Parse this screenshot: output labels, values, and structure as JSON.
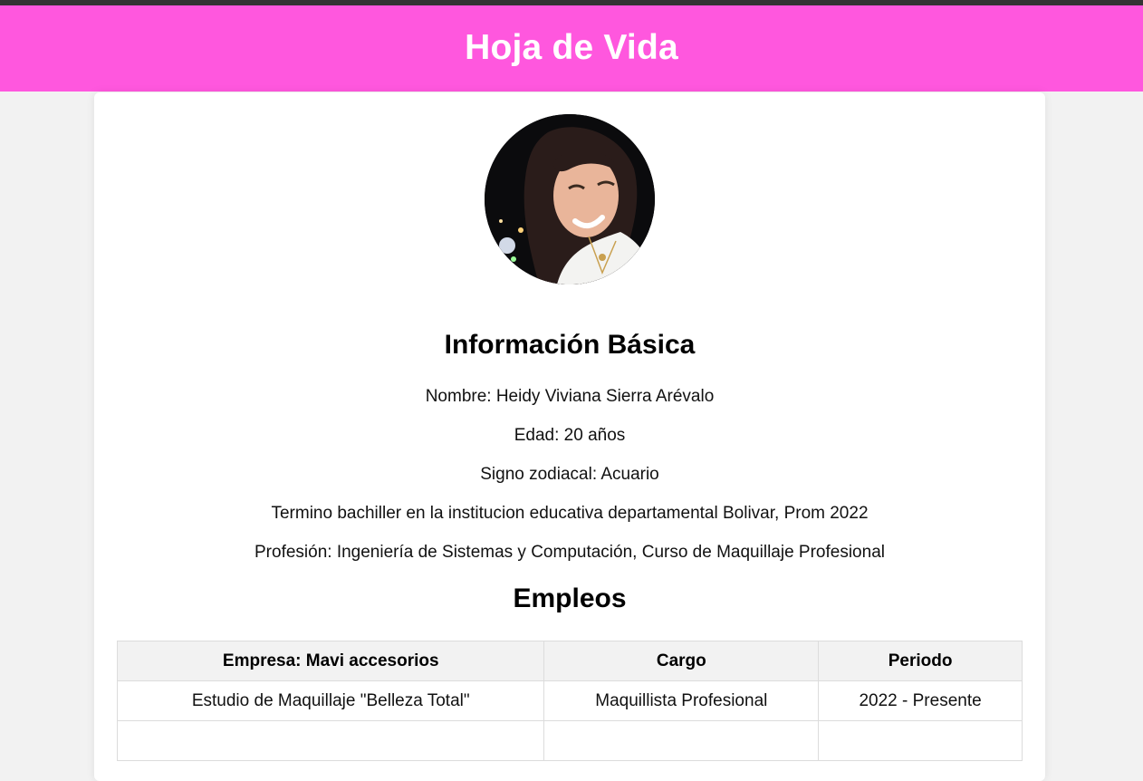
{
  "page": {
    "title": "Hoja de Vida"
  },
  "basic_info": {
    "heading": "Información Básica",
    "lines": [
      "Nombre: Heidy Viviana Sierra Arévalo",
      "Edad: 20 años",
      "Signo zodiacal: Acuario",
      "Termino bachiller en la institucion educativa departamental Bolivar, Prom 2022",
      "Profesión: Ingeniería de Sistemas y Computación, Curso de Maquillaje Profesional"
    ]
  },
  "employment": {
    "heading": "Empleos",
    "columns": [
      "Empresa: Mavi accesorios",
      "Cargo",
      "Periodo"
    ],
    "rows": [
      [
        "Estudio de Maquillaje \"Belleza Total\"",
        "Maquillista Profesional",
        "2022 - Presente"
      ],
      [
        "",
        "",
        ""
      ]
    ]
  },
  "colors": {
    "header_bg": "#ff57de",
    "top_strip": "#333333",
    "page_bg": "#f2f2f2",
    "card_bg": "#ffffff"
  },
  "icons": {
    "avatar": "profile-photo"
  }
}
